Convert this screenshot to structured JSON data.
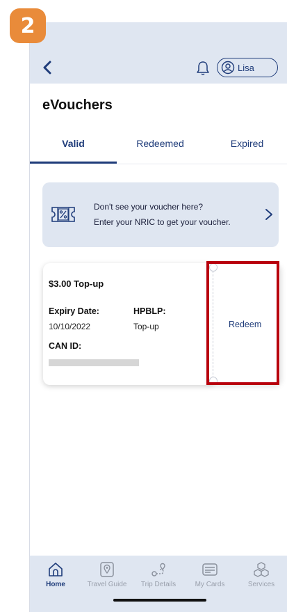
{
  "step_badge": "2",
  "header": {
    "user_name": "Lisa"
  },
  "page_title": "eVouchers",
  "tabs": [
    {
      "label": "Valid",
      "active": true
    },
    {
      "label": "Redeemed",
      "active": false
    },
    {
      "label": "Expired",
      "active": false
    }
  ],
  "info_banner": {
    "line1": "Don't see your voucher here?",
    "line2": "Enter your NRIC to get your voucher."
  },
  "voucher": {
    "title": "$3.00 Top-up",
    "expiry_label": "Expiry Date:",
    "expiry_value": "10/10/2022",
    "hpblp_label": "HPBLP:",
    "hpblp_value": "Top-up",
    "can_label": "CAN ID:",
    "redeem_label": "Redeem"
  },
  "bottom_nav": [
    {
      "label": "Home",
      "icon": "home-icon",
      "active": true
    },
    {
      "label": "Travel Guide",
      "icon": "map-pin-icon",
      "active": false
    },
    {
      "label": "Trip Details",
      "icon": "route-icon",
      "active": false
    },
    {
      "label": "My Cards",
      "icon": "card-icon",
      "active": false
    },
    {
      "label": "Services",
      "icon": "boxes-icon",
      "active": false
    }
  ],
  "colors": {
    "accent": "#1f3c7a",
    "header_bg": "#dfe6f1",
    "badge": "#e98b3a",
    "highlight": "#b8000d"
  }
}
